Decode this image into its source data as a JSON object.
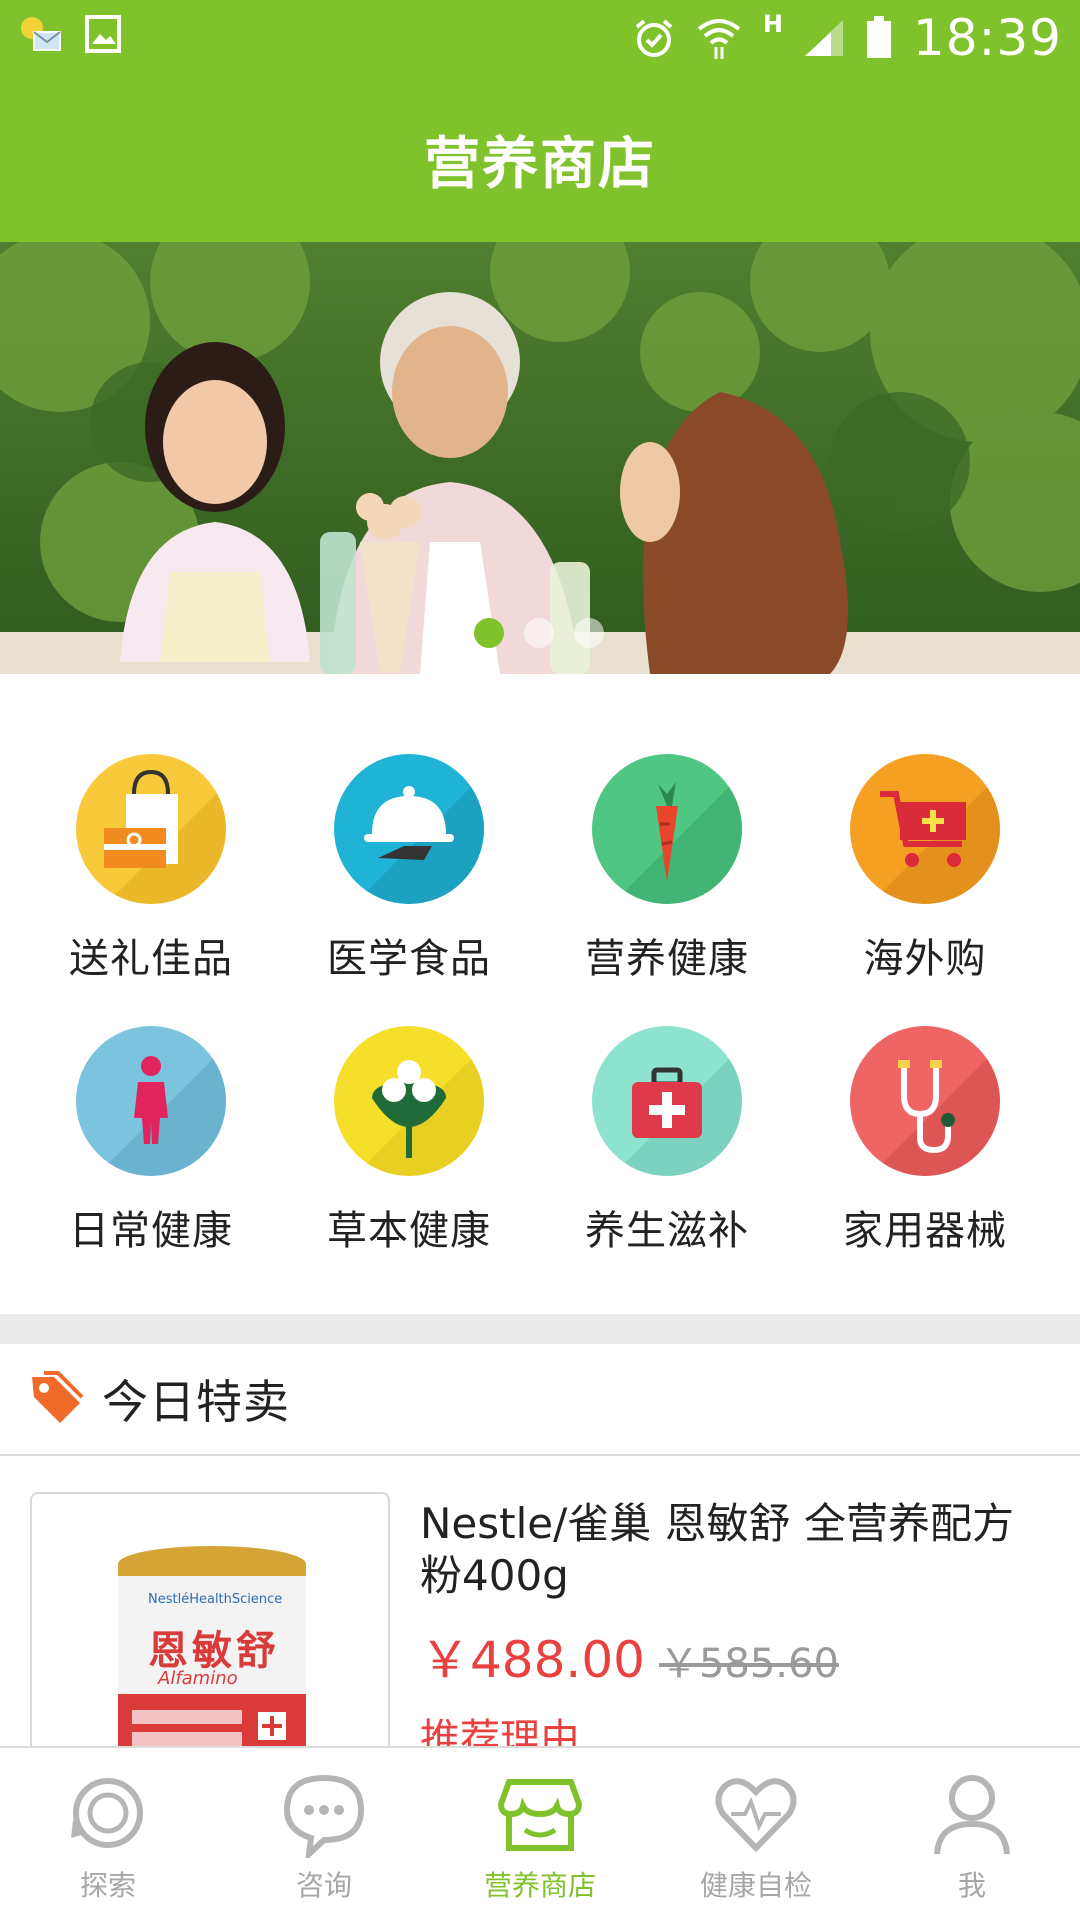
{
  "status_bar": {
    "time": "18:39",
    "network_label": "H"
  },
  "header": {
    "title": "营养商店"
  },
  "banner": {
    "slide_count": 3,
    "active_slide": 1
  },
  "categories": [
    {
      "label": "送礼佳品",
      "icon": "gift-bag-icon",
      "color": "#f8c93a"
    },
    {
      "label": "医学食品",
      "icon": "serving-cloche-icon",
      "color": "#1fb4d6"
    },
    {
      "label": "营养健康",
      "icon": "carrot-icon",
      "color": "#4fc783"
    },
    {
      "label": "海外购",
      "icon": "shopping-cart-plus-icon",
      "color": "#f5a022"
    },
    {
      "label": "日常健康",
      "icon": "person-icon",
      "color": "#7cc3de"
    },
    {
      "label": "草本健康",
      "icon": "herb-leaf-icon",
      "color": "#f6df2b"
    },
    {
      "label": "养生滋补",
      "icon": "first-aid-kit-icon",
      "color": "#8ee3cf"
    },
    {
      "label": "家用器械",
      "icon": "stethoscope-icon",
      "color": "#ef6565"
    }
  ],
  "deal": {
    "title": "今日特卖",
    "product": {
      "name": "Nestle/雀巢 恩敏舒 全营养配方粉400g",
      "price": "￥488.00",
      "original_price": "￥585.60",
      "reason_label": "推荐理由",
      "package_brand": "NestléHealthScience",
      "package_title": "恩敏舒",
      "package_subtitle": "Alfamino"
    }
  },
  "bottom_nav": [
    {
      "label": "探索",
      "icon": "explore-refresh-icon",
      "active": false
    },
    {
      "label": "咨询",
      "icon": "chat-bubble-icon",
      "active": false
    },
    {
      "label": "营养商店",
      "icon": "store-icon",
      "active": true
    },
    {
      "label": "健康自检",
      "icon": "heart-pulse-icon",
      "active": false
    },
    {
      "label": "我",
      "icon": "user-icon",
      "active": false
    }
  ],
  "colors": {
    "brand": "#80c22c",
    "price": "#e94040",
    "inactive": "#a7a7a7"
  }
}
